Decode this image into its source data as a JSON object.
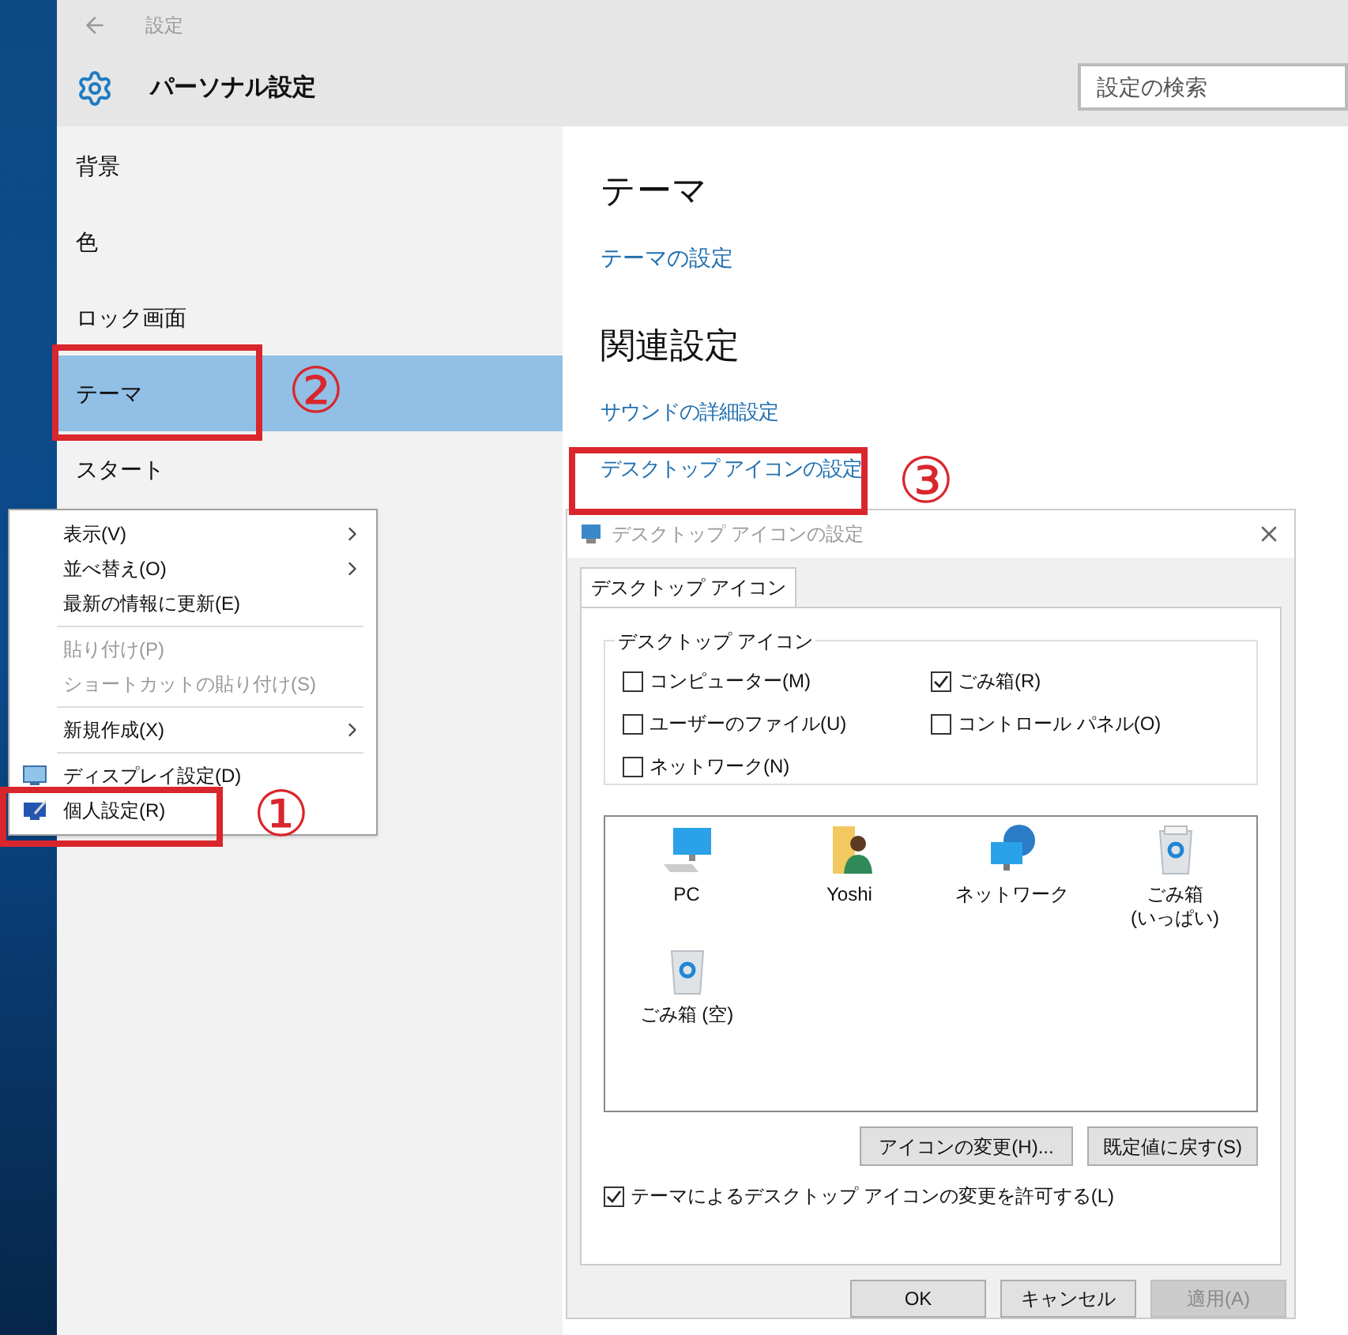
{
  "settings": {
    "breadcrumb": "設定",
    "title": "パーソナル設定",
    "search": {
      "placeholder": "設定の検索"
    },
    "nav": [
      {
        "label": "背景",
        "selected": false
      },
      {
        "label": "色",
        "selected": false
      },
      {
        "label": "ロック画面",
        "selected": false
      },
      {
        "label": "テーマ",
        "selected": true
      },
      {
        "label": "スタート",
        "selected": false
      }
    ],
    "heading": "テーマ",
    "theme_link": "テーマの設定",
    "related_heading": "関連設定",
    "related_links": [
      "サウンドの詳細設定",
      "デスクトップ アイコンの設定"
    ]
  },
  "context_menu": {
    "groups": [
      [
        {
          "label": "表示(V)",
          "kind": "submenu",
          "disabled": false
        },
        {
          "label": "並べ替え(O)",
          "kind": "submenu",
          "disabled": false
        },
        {
          "label": "最新の情報に更新(E)",
          "kind": "command",
          "disabled": false
        }
      ],
      [
        {
          "label": "貼り付け(P)",
          "kind": "command",
          "disabled": true
        },
        {
          "label": "ショートカットの貼り付け(S)",
          "kind": "command",
          "disabled": true
        }
      ],
      [
        {
          "label": "新規作成(X)",
          "kind": "submenu",
          "disabled": false
        }
      ],
      [
        {
          "label": "ディスプレイ設定(D)",
          "kind": "display",
          "disabled": false
        },
        {
          "label": "個人設定(R)",
          "kind": "personalize",
          "disabled": false
        }
      ]
    ]
  },
  "dialog": {
    "title": "デスクトップ アイコンの設定",
    "tab": "デスクトップ アイコン",
    "group_title": "デスクトップ アイコン",
    "checkboxes": [
      {
        "label": "コンピューター(M)",
        "checked": false
      },
      {
        "label": "ごみ箱(R)",
        "checked": true
      },
      {
        "label": "ユーザーのファイル(U)",
        "checked": false
      },
      {
        "label": "コントロール パネル(O)",
        "checked": false
      },
      {
        "label": "ネットワーク(N)",
        "checked": false
      }
    ],
    "icons": [
      {
        "label": "PC",
        "kind": "computer"
      },
      {
        "label": "Yoshi",
        "kind": "user_folder"
      },
      {
        "label": "ネットワーク",
        "kind": "network"
      },
      {
        "label": "ごみ箱\n(いっぱい)",
        "kind": "bin_full"
      },
      {
        "label": "ごみ箱 (空)",
        "kind": "bin_empty"
      }
    ],
    "change_button": "アイコンの変更(H)...",
    "default_button": "既定値に戻す(S)",
    "allow_themes": {
      "label": "テーマによるデスクトップ アイコンの変更を許可する(L)",
      "checked": true
    },
    "buttons": [
      {
        "label": "OK",
        "disabled": false
      },
      {
        "label": "キャンセル",
        "disabled": false
      },
      {
        "label": "適用(A)",
        "disabled": true
      }
    ]
  },
  "annotations": [
    {
      "label": "①"
    },
    {
      "label": "②"
    },
    {
      "label": "③"
    }
  ]
}
